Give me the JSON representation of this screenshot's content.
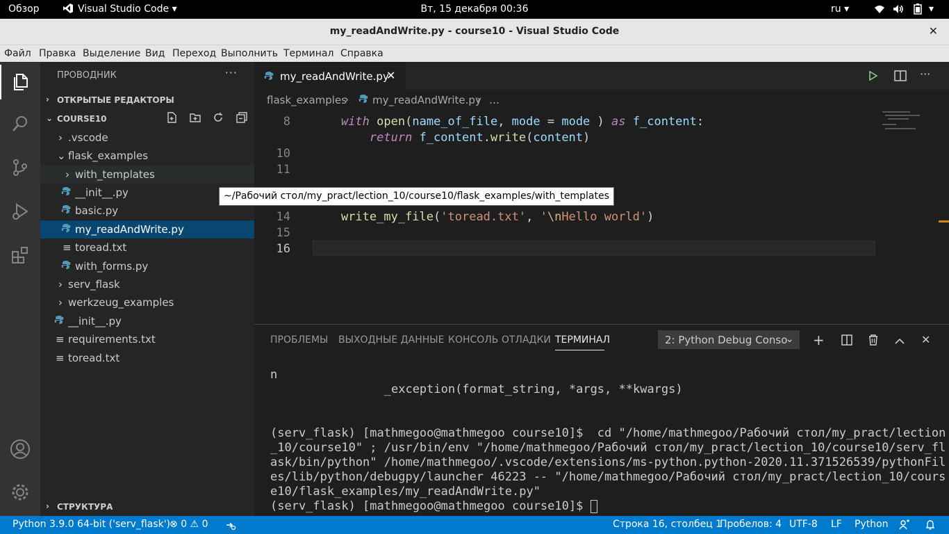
{
  "gnome": {
    "overview": "Обзор",
    "app_name": "Visual Studio Code",
    "clock": "Вт, 15 декабря  00:36",
    "keyboard_layout": "ru"
  },
  "window": {
    "title": "my_readAndWrite.py - course10 - Visual Studio Code"
  },
  "menu": [
    "Файл",
    "Правка",
    "Выделение",
    "Вид",
    "Переход",
    "Выполнить",
    "Терминал",
    "Справка"
  ],
  "sidebar": {
    "header": "ПРОВОДНИК",
    "open_editors": "ОТКРЫТЫЕ РЕДАКТОРЫ",
    "project": "COURSE10",
    "outline": "СТРУКТУРА",
    "tree": [
      {
        "label": ".vscode",
        "type": "folder-closed"
      },
      {
        "label": "flask_examples",
        "type": "folder-open"
      },
      {
        "label": "with_templates",
        "type": "folder-closed"
      },
      {
        "label": "__init__.py",
        "type": "python"
      },
      {
        "label": "basic.py",
        "type": "python"
      },
      {
        "label": "my_readAndWrite.py",
        "type": "python"
      },
      {
        "label": "toread.txt",
        "type": "text"
      },
      {
        "label": "with_forms.py",
        "type": "python"
      },
      {
        "label": "serv_flask",
        "type": "folder-closed"
      },
      {
        "label": "werkzeug_examples",
        "type": "folder-closed"
      },
      {
        "label": "__init__.py",
        "type": "python"
      },
      {
        "label": "requirements.txt",
        "type": "text"
      },
      {
        "label": "toread.txt",
        "type": "text"
      }
    ]
  },
  "editor": {
    "tab_label": "my_readAndWrite.py",
    "breadcrumb": [
      "flask_examples",
      "my_readAndWrite.py",
      "…"
    ],
    "line_numbers": [
      "8",
      "10",
      "11",
      "14",
      "15",
      "16"
    ],
    "code": {
      "l8_with": "with",
      "l8_open": "open",
      "l8_name": "name_of_file",
      "l8_mode": "mode",
      "l8_mode2": "mode",
      "l8_as": "as",
      "l8_fcontent": "f_content",
      "l9_return": "return",
      "l9_obj": "f_content",
      "l9_write": "write",
      "l9_content": "content",
      "l14_fn": "write_my_file",
      "l14_s1": "'toread.txt'",
      "l14_s2a": "'",
      "l14_esc": "\\n",
      "l14_s2b": "Hello world'"
    },
    "tooltip": "~/Рабочий стол/my_pract/lection_10/course10/flask_examples/with_templates"
  },
  "panel": {
    "tabs": [
      "ПРОБЛЕМЫ",
      "ВЫХОДНЫЕ ДАННЫЕ",
      "КОНСОЛЬ ОТЛАДКИ",
      "ТЕРМИНАЛ"
    ],
    "terminal_select": "2: Python Debug Conso",
    "lines": [
      "n",
      "                _exception(format_string, *args, **kwargs)",
      "",
      "",
      "(serv_flask) [mathmegoo@mathmegoo course10]$  cd \"/home/mathmegoo/Рабочий стол/my_pract/lection",
      "_10/course10\" ; /usr/bin/env \"/home/mathmegoo/Рабочий стол/my_pract/lection_10/course10/serv_fl",
      "ask/bin/python\" /home/mathmegoo/.vscode/extensions/ms-python.python-2020.11.371526539/pythonFil",
      "es/lib/python/debugpy/launcher 46223 -- \"/home/mathmegoo/Рабочий стол/my_pract/lection_10/cours",
      "e10/flask_examples/my_readAndWrite.py\"",
      "(serv_flask) [mathmegoo@mathmegoo course10]$ "
    ]
  },
  "status": {
    "interpreter": "Python 3.9.0 64-bit ('serv_flask')",
    "errors": "0",
    "warnings": "0",
    "position": "Строка 16, столбец 1",
    "spaces": "Пробелов: 4",
    "encoding": "UTF-8",
    "eol": "LF",
    "language": "Python"
  },
  "colors": {
    "accent": "#007acc",
    "selection": "#094771"
  }
}
